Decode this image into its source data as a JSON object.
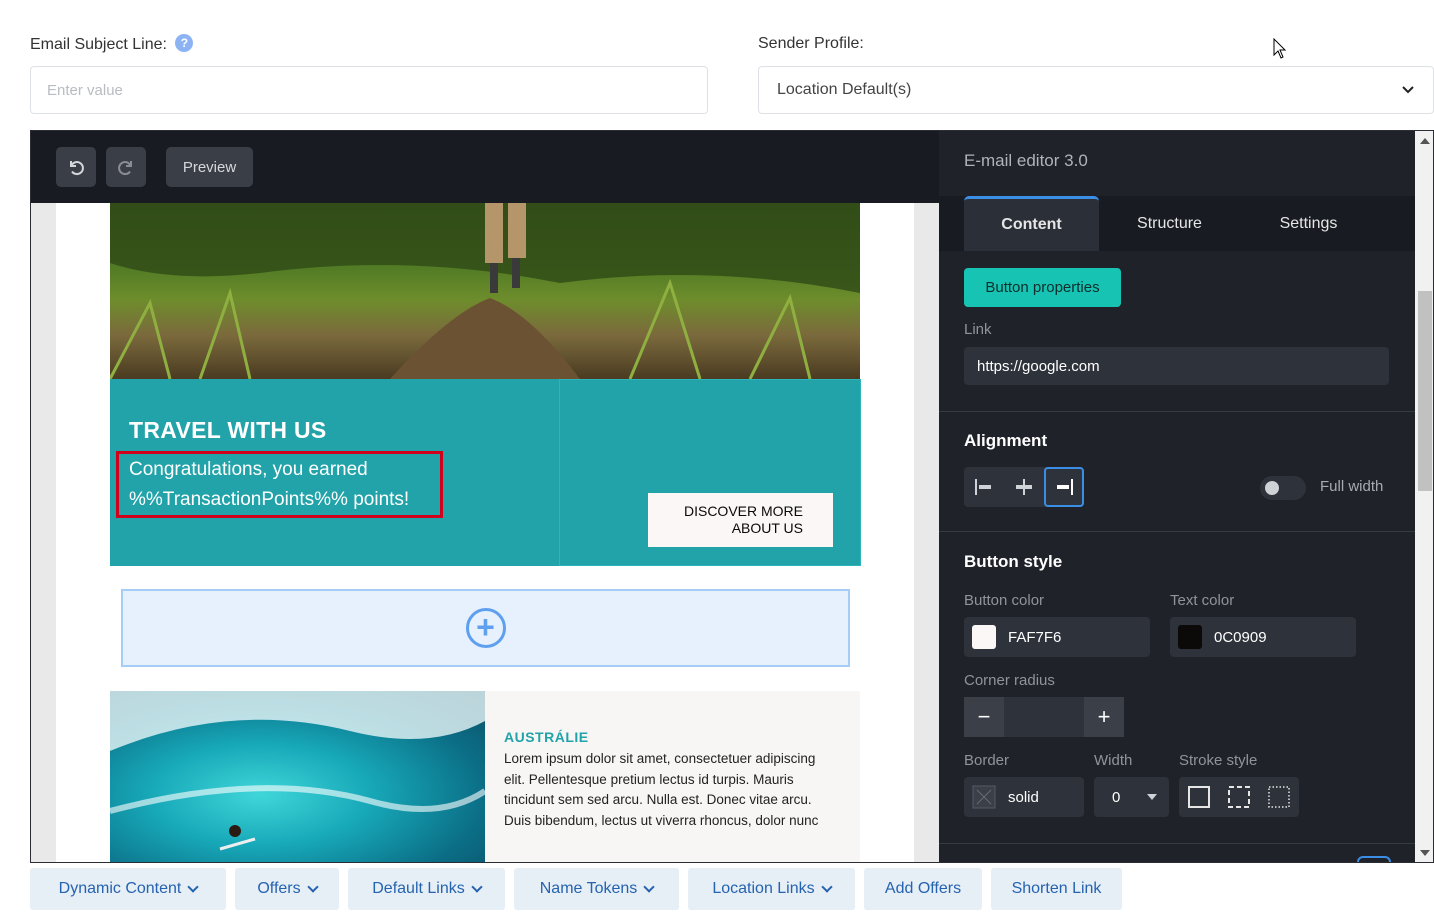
{
  "form": {
    "subject_label": "Email Subject Line:",
    "help_glyph": "?",
    "subject_placeholder": "Enter value",
    "sender_label": "Sender Profile:",
    "sender_value": "Location Default(s)"
  },
  "toolbar": {
    "preview_label": "Preview"
  },
  "email": {
    "hero_title": "TRAVEL WITH  US",
    "hero_text_line1": "Congratulations, you earned",
    "hero_text_line2": "%%TransactionPoints%% points!",
    "cta_line1": "DISCOVER MORE",
    "cta_line2": "ABOUT US",
    "article_title": "AUSTRÁLIE",
    "article_body": "Lorem ipsum dolor sit amet, consectetuer adipiscing elit. Pellentesque pretium lectus id turpis. Mauris tincidunt sem sed arcu. Nulla est. Donec vitae arcu. Duis bibendum, lectus ut viverra rhoncus, dolor nunc"
  },
  "panel": {
    "title": "E-mail editor 3.0",
    "tabs": [
      {
        "label": "Content",
        "active": true
      },
      {
        "label": "Structure",
        "active": false
      },
      {
        "label": "Settings",
        "active": false
      }
    ],
    "badge": "Button properties",
    "link_label": "Link",
    "link_value": "https://google.com",
    "alignment_heading": "Alignment",
    "alignment_selected": "right",
    "full_width_label": "Full width",
    "full_width_on": false,
    "button_style_heading": "Button style",
    "button_color_label": "Button color",
    "button_color_value": "FAF7F6",
    "button_color_hex": "#FAF7F6",
    "text_color_label": "Text color",
    "text_color_value": "0C0909",
    "text_color_hex": "#0C0909",
    "corner_radius_label": "Corner radius",
    "corner_radius_value": "",
    "border_label": "Border",
    "border_value": "solid",
    "width_label": "Width",
    "width_value": "0",
    "stroke_label": "Stroke style"
  },
  "bottom_bar": [
    {
      "label": "Dynamic Content",
      "dropdown": true
    },
    {
      "label": "Offers",
      "dropdown": true
    },
    {
      "label": "Default Links",
      "dropdown": true
    },
    {
      "label": "Name Tokens",
      "dropdown": true
    },
    {
      "label": "Location Links",
      "dropdown": true
    },
    {
      "label": "Add Offers",
      "dropdown": false
    },
    {
      "label": "Shorten Link",
      "dropdown": false
    }
  ],
  "colors": {
    "accent_teal": "#21A3A9",
    "panel_bg": "#1F2228",
    "highlight_red": "#D0021B",
    "link_blue": "#2563B0"
  }
}
